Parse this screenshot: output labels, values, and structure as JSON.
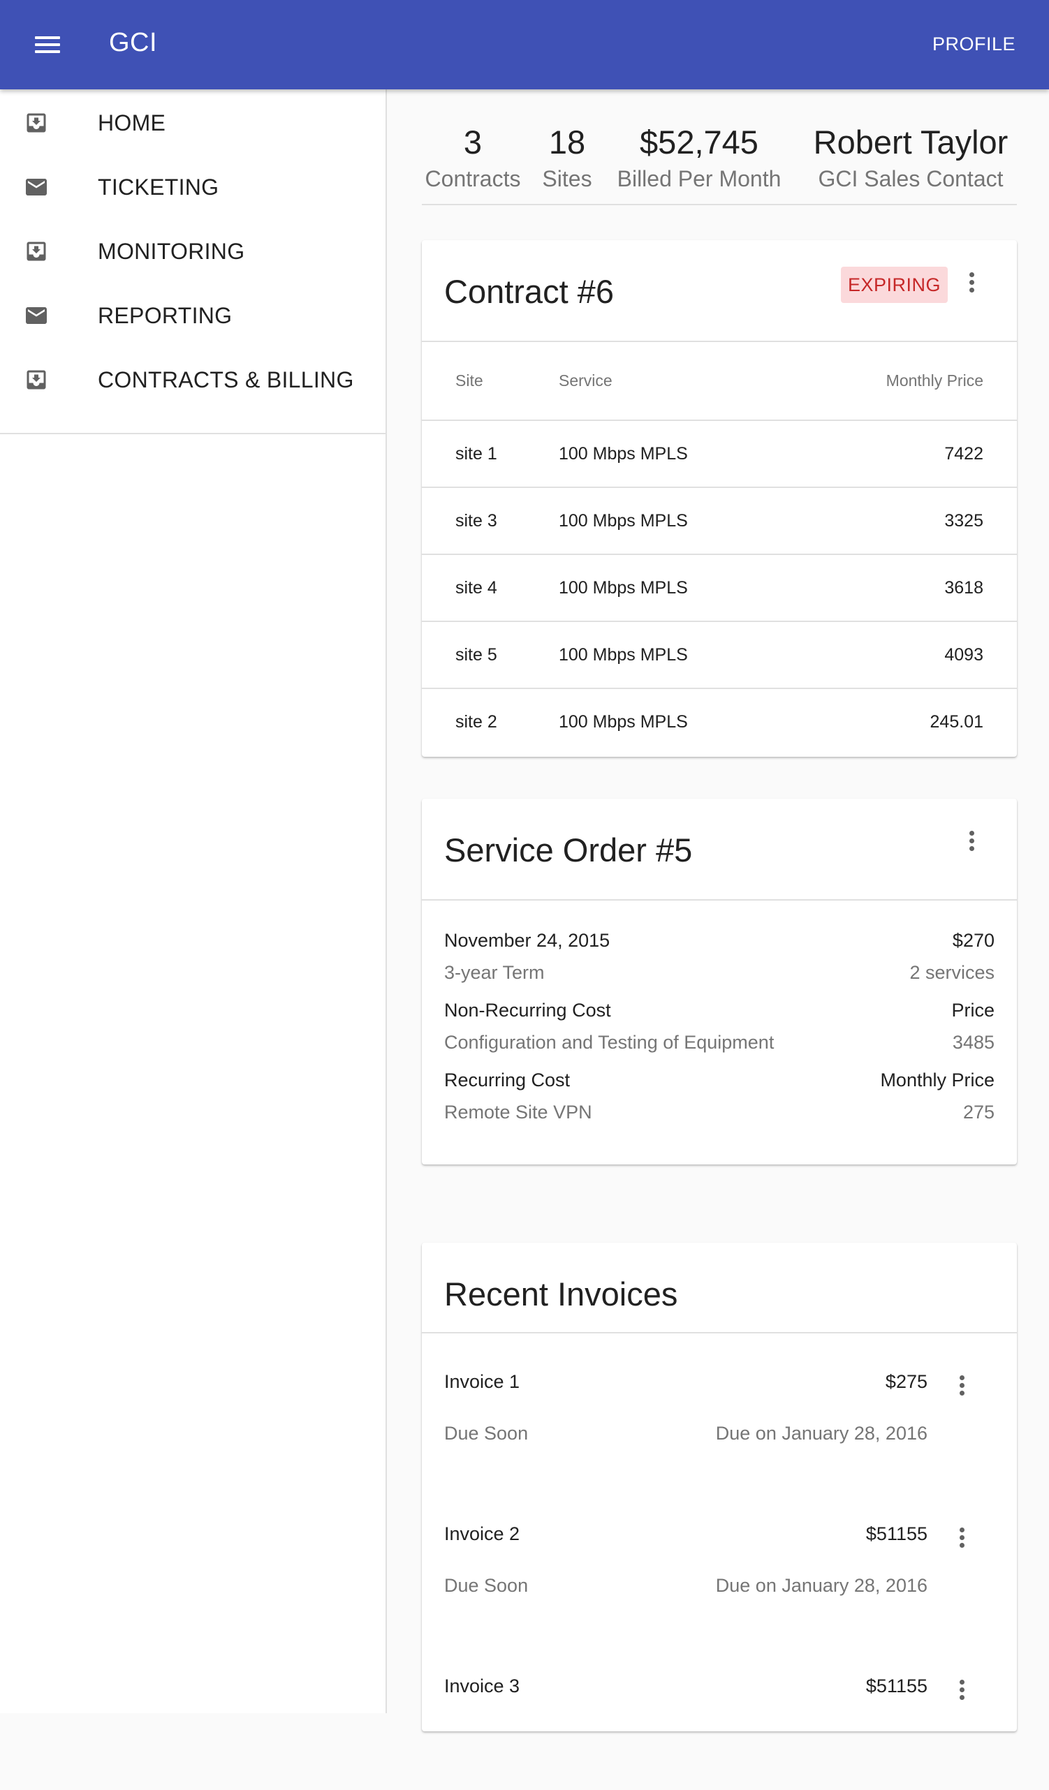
{
  "app": {
    "title": "GCI",
    "profile_label": "PROFILE"
  },
  "sidebar": {
    "items": [
      {
        "label": "HOME",
        "icon": "inbox-download-icon"
      },
      {
        "label": "TICKETING",
        "icon": "mail-icon"
      },
      {
        "label": "MONITORING",
        "icon": "inbox-download-icon"
      },
      {
        "label": "REPORTING",
        "icon": "mail-icon"
      },
      {
        "label": "CONTRACTS & BILLING",
        "icon": "inbox-download-icon"
      }
    ]
  },
  "stats": [
    {
      "value": "3",
      "label": "Contracts"
    },
    {
      "value": "18",
      "label": "Sites"
    },
    {
      "value": "$52,745",
      "label": "Billed Per Month"
    },
    {
      "value": "Robert Taylor",
      "label": "GCI Sales Contact"
    }
  ],
  "contract": {
    "title": "Contract #6",
    "badge": "EXPIRING",
    "columns": [
      "Site",
      "Service",
      "Monthly Price"
    ],
    "rows": [
      [
        "site 1",
        "100 Mbps MPLS",
        "7422"
      ],
      [
        "site 3",
        "100 Mbps MPLS",
        "3325"
      ],
      [
        "site 4",
        "100 Mbps MPLS",
        "3618"
      ],
      [
        "site 5",
        "100 Mbps MPLS",
        "4093"
      ],
      [
        "site 2",
        "100 Mbps MPLS",
        "245.01"
      ]
    ]
  },
  "service_order": {
    "title": "Service Order #5",
    "date": "November 24, 2015",
    "total": "$270",
    "term": "3-year Term",
    "services": "2 services",
    "nonrecurring_label": "Non-Recurring Cost",
    "price_label": "Price",
    "nonrecurring_item": "Configuration and Testing of Equipment",
    "nonrecurring_price": "3485",
    "recurring_label": "Recurring Cost",
    "monthly_price_label": "Monthly Price",
    "recurring_item": "Remote Site VPN",
    "recurring_price": "275"
  },
  "invoices": {
    "title": "Recent Invoices",
    "items": [
      {
        "name": "Invoice 1",
        "amount": "$275",
        "status": "Due Soon",
        "due": "Due on January 28, 2016"
      },
      {
        "name": "Invoice 2",
        "amount": "$51155",
        "status": "Due Soon",
        "due": "Due on January 28, 2016"
      },
      {
        "name": "Invoice 3",
        "amount": "$51155"
      }
    ]
  },
  "colors": {
    "primary": "#3f51b5",
    "badge_bg": "#fbd9db",
    "badge_text": "#c62828"
  }
}
